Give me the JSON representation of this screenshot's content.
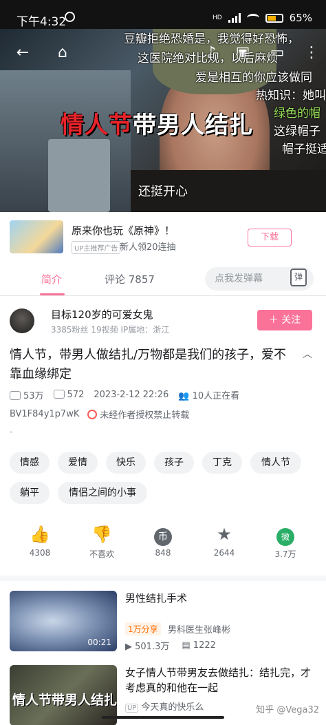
{
  "status": {
    "time": "下午4:32",
    "battery": "65%",
    "network": "HD"
  },
  "video": {
    "caption_big_red": "情人节",
    "caption_big_white": "带男人结扎",
    "subtitle": "还挺开心",
    "danmaku": [
      "豆瓣拒绝恐婚是，我觉得好恐怖，",
      "这医院绝对比规，以后麻烦",
      "爱是相互的你应该做同",
      "热知识：她叫",
      "绿色的帽",
      "这绿帽子",
      "帽子挺适"
    ]
  },
  "ad": {
    "title": "原来你也玩《原神》！",
    "tag": "UP主推荐广告",
    "subtitle": "新人领20连抽",
    "download": "下载"
  },
  "tabs": {
    "intro": "简介",
    "comments": "评论 7857",
    "danmaku_placeholder": "点我发弹幕",
    "danmaku_toggle": "弹"
  },
  "uploader": {
    "name": "目标120岁的可爱女鬼",
    "stats": "3385粉丝   19视频   IP属地：浙江",
    "follow": "＋ 关注"
  },
  "detail": {
    "title": "情人节，带男人做结扎/万物都是我们的孩子，爱不靠血缘绑定",
    "views": "53万",
    "danmaku_count": "572",
    "date": "2023-2-12 22:26",
    "watching": "10人正在看",
    "bvid": "BV1F84y1p7wK",
    "notice": "未经作者授权禁止转载",
    "desc": "-"
  },
  "tags": [
    "情感",
    "爱情",
    "快乐",
    "孩子",
    "丁克",
    "情人节",
    "躺平",
    "情侣之间的小事"
  ],
  "actions": {
    "like": "4308",
    "dislike": "不喜欢",
    "coin": "848",
    "favorite": "2644",
    "share": "3.7万"
  },
  "recommendations": [
    {
      "title": "男性结扎手术",
      "badge": "1万分享",
      "author": "男科医生张峰彬",
      "duration": "00:21",
      "views": "501.3万",
      "danmaku": "1222"
    },
    {
      "title": "女子情人节带男友去做结扎：结扎完，才考虑真的和他在一起",
      "author": "今天真的快乐么",
      "up": "UP",
      "cover_text": "情人节带男人结扎"
    }
  ],
  "watermark": "知乎 @Vega32"
}
